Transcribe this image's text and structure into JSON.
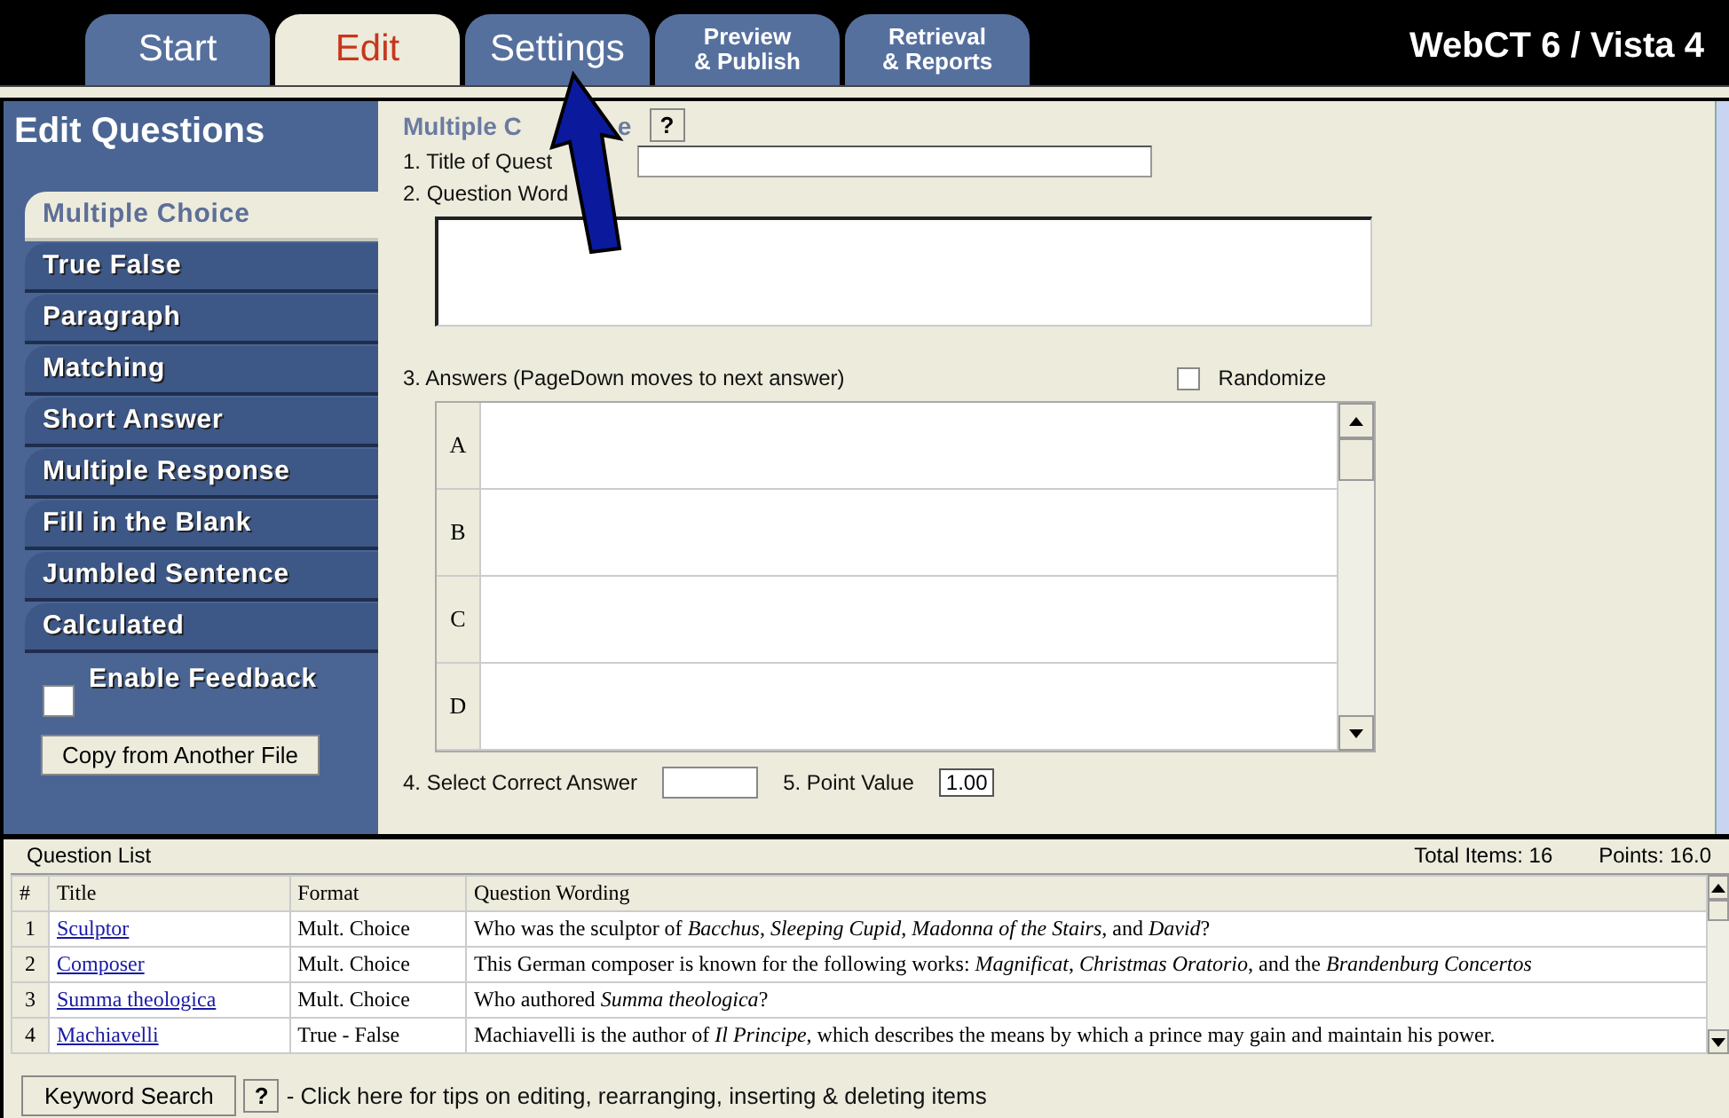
{
  "header": {
    "tabs": [
      {
        "label": "Start",
        "selected": false
      },
      {
        "label": "Edit",
        "selected": true
      },
      {
        "label": "Settings",
        "selected": false
      },
      {
        "label": "Preview\n& Publish",
        "selected": false
      },
      {
        "label": "Retrieval\n& Reports",
        "selected": false
      }
    ],
    "product": "WebCT 6 / Vista 4"
  },
  "sidebar": {
    "title": "Edit Questions",
    "items": [
      {
        "label": "Multiple Choice",
        "selected": true
      },
      {
        "label": "True False",
        "selected": false
      },
      {
        "label": "Paragraph",
        "selected": false
      },
      {
        "label": "Matching",
        "selected": false
      },
      {
        "label": "Short Answer",
        "selected": false
      },
      {
        "label": "Multiple Response",
        "selected": false
      },
      {
        "label": "Fill in the Blank",
        "selected": false
      },
      {
        "label": "Jumbled Sentence",
        "selected": false
      },
      {
        "label": "Calculated",
        "selected": false
      }
    ],
    "enable_feedback": {
      "label": "Enable Feedback",
      "checked": false
    },
    "copy_button": "Copy from Another File"
  },
  "form": {
    "heading": [
      "Multiple C",
      "e"
    ],
    "help": "?",
    "title_label": "1.  Title of Quest",
    "wording_label": "2.  Question Word",
    "answers_label": "3.  Answers  (PageDown moves to next answer)",
    "randomize": {
      "label": "Randomize",
      "checked": false
    },
    "answers": [
      "A",
      "B",
      "C",
      "D"
    ],
    "correct_label": "4.  Select Correct Answer",
    "points_label": "5.  Point Value",
    "points_value": "1.00"
  },
  "question_list": {
    "title": "Question List",
    "total_items": "Total Items: 16",
    "points": "Points: 16.0",
    "columns": [
      "#",
      "Title",
      "Format",
      "Question Wording"
    ],
    "rows": [
      {
        "n": "1",
        "title": "Sculptor",
        "format": "Mult. Choice",
        "wording": "Who was the sculptor of *Bacchus*, *Sleeping Cupid*, *Madonna of the Stairs*, and *David*?"
      },
      {
        "n": "2",
        "title": "Composer",
        "format": "Mult. Choice",
        "wording": "This German composer is known for the following works: *Magnificat*, *Christmas Oratorio*, and the *Brandenburg Concertos*"
      },
      {
        "n": "3",
        "title": "Summa theologica",
        "format": "Mult. Choice",
        "wording": "Who authored *Summa theologica*?"
      },
      {
        "n": "4",
        "title": "Machiavelli",
        "format": "True - False",
        "wording": "Machiavelli is the author of *Il Principe*, which describes the means by which a prince may gain and maintain his power."
      }
    ]
  },
  "footer": {
    "search_button": "Keyword Search",
    "help": "?",
    "tip": "- Click here for tips on editing, rearranging, inserting & deleting items"
  }
}
